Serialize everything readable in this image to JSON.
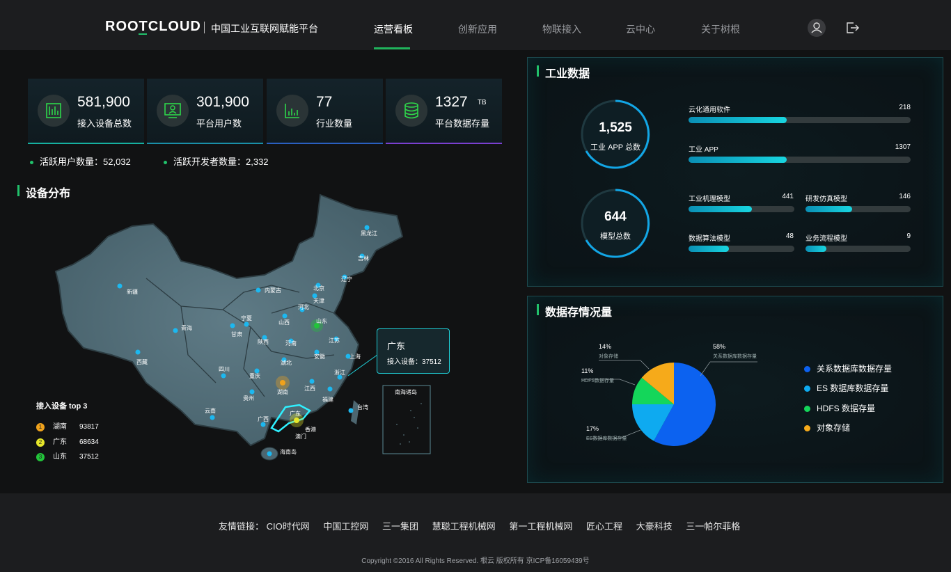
{
  "header": {
    "logo": "ROOTCLOUD",
    "subtitle": "中国工业互联网赋能平台",
    "nav": [
      {
        "label": "运营看板",
        "active": true
      },
      {
        "label": "创新应用",
        "active": false
      },
      {
        "label": "物联接入",
        "active": false
      },
      {
        "label": "云中心",
        "active": false
      },
      {
        "label": "关于树根",
        "active": false
      }
    ],
    "user_icon": "user-icon",
    "logout_icon": "logout-icon"
  },
  "kpis": [
    {
      "value": "581,900",
      "unit": "",
      "label": "接入设备总数",
      "icon": "device-icon",
      "line": "#16b0a0"
    },
    {
      "value": "301,900",
      "unit": "",
      "label": "平台用户数",
      "icon": "user-monitor-icon",
      "line": "#1a8fa8"
    },
    {
      "value": "77",
      "unit": "",
      "label": "行业数量",
      "icon": "industry-chart-icon",
      "line": "#2a5fc0"
    },
    {
      "value": "1327",
      "unit": "TB",
      "label": "平台数据存量",
      "icon": "database-icon",
      "line": "#7a3fd0"
    }
  ],
  "active_stats": [
    {
      "label": "活跃用户数量：52,032"
    },
    {
      "label": "活跃开发者数量：2,332"
    }
  ],
  "device_map": {
    "title": "设备分布",
    "provinces": [
      "黑龙江",
      "吉林",
      "辽宁",
      "北京",
      "天津",
      "河北",
      "内蒙古",
      "新疆",
      "青海",
      "甘肃",
      "宁夏",
      "山西",
      "山东",
      "陕西",
      "河南",
      "江苏",
      "上海",
      "安徽",
      "湖北",
      "西藏",
      "四川",
      "重庆",
      "浙江",
      "贵州",
      "湖南",
      "江西",
      "福建",
      "台湾",
      "云南",
      "广西",
      "广东",
      "香港",
      "澳门",
      "海南岛"
    ],
    "south_sea_label": "南海诸岛",
    "tooltip": {
      "title": "广东",
      "text": "接入设备：37512"
    },
    "top3_title": "接入设备 top 3",
    "top3": [
      {
        "rank": "1",
        "name": "湖南",
        "value": "93817",
        "color": "#f0a21c"
      },
      {
        "rank": "2",
        "name": "广东",
        "value": "68634",
        "color": "#e7e72a"
      },
      {
        "rank": "3",
        "name": "山东",
        "value": "37512",
        "color": "#22c43a"
      }
    ]
  },
  "industrial": {
    "title": "工业数据",
    "rings": [
      {
        "value": "1,525",
        "label": "工业 APP 总数"
      },
      {
        "value": "644",
        "label": "模型总数"
      }
    ],
    "bars_wide": [
      {
        "label": "云化通用软件",
        "value": "218",
        "ratio": 0.44
      },
      {
        "label": "工业 APP",
        "value": "1307",
        "ratio": 0.44
      }
    ],
    "bars_grid": [
      {
        "label": "工业机理模型",
        "value": "441",
        "ratio": 0.6
      },
      {
        "label": "研发仿真模型",
        "value": "146",
        "ratio": 0.44
      },
      {
        "label": "数据算法模型",
        "value": "48",
        "ratio": 0.38
      },
      {
        "label": "业务流程模型",
        "value": "9",
        "ratio": 0.2
      }
    ]
  },
  "storage": {
    "title": "数据存情况量",
    "chart_data": {
      "type": "pie",
      "slices": [
        {
          "name": "关系数据库数据存量",
          "value": 58,
          "pct": "58%",
          "color": "#0c62f0"
        },
        {
          "name": "ES数据库数据存量",
          "value": 17,
          "pct": "17%",
          "color": "#0eaaf0"
        },
        {
          "name": "HDFS数据存量",
          "value": 11,
          "pct": "11%",
          "color": "#14d65a"
        },
        {
          "name": "对象存储",
          "value": 14,
          "pct": "14%",
          "color": "#f6aa1a"
        }
      ]
    },
    "legend": [
      {
        "label": "关系数据库数据存量",
        "color": "#0c62f0"
      },
      {
        "label": "ES 数据库数据存量",
        "color": "#0eaaf0"
      },
      {
        "label": "HDFS 数据存量",
        "color": "#14d65a"
      },
      {
        "label": "对象存储",
        "color": "#f6aa1a"
      }
    ]
  },
  "footer": {
    "links_label": "友情链接：",
    "links": [
      "CIO时代网",
      "中国工控网",
      "三一集团",
      "慧聪工程机械网",
      "第一工程机械网",
      "匠心工程",
      "大豪科技",
      "三一帕尔菲格"
    ],
    "copyright": "Copyright ©2016 All Rights Reserved. 根云 版权所有 京ICP备16059439号"
  }
}
